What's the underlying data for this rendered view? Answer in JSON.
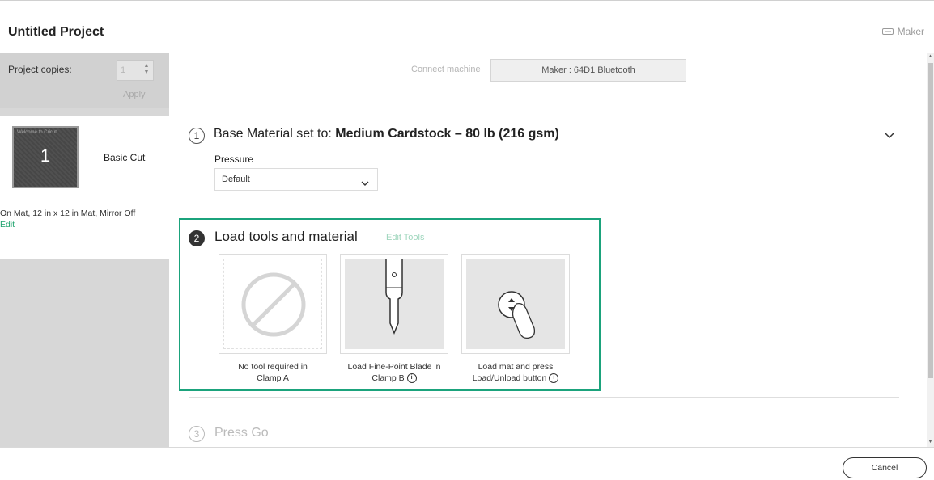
{
  "header": {
    "title": "Untitled Project",
    "machine_label": "Maker"
  },
  "sidebar": {
    "copies_label": "Project copies:",
    "copies_value": "1",
    "apply_label": "Apply",
    "mat": {
      "number": "1",
      "thumb_tag": "Welcome to Cricut",
      "label": "Basic Cut",
      "description": "On Mat, 12 in x 12 in Mat, Mirror Off",
      "edit_label": "Edit"
    }
  },
  "connect": {
    "label": "Connect machine",
    "selected": "Maker : 64D1 Bluetooth"
  },
  "step1": {
    "number": "1",
    "prefix": "Base Material set to:",
    "material": "Medium Cardstock – 80 lb (216 gsm)",
    "pressure_label": "Pressure",
    "pressure_value": "Default"
  },
  "step2": {
    "number": "2",
    "title": "Load tools and material",
    "edit_tools": "Edit Tools",
    "tools": [
      {
        "caption_line1": "No tool required in",
        "caption_line2": "Clamp A"
      },
      {
        "caption_line1": "Load Fine-Point Blade in",
        "caption_line2": "Clamp B"
      },
      {
        "caption_line1": "Load mat and press",
        "caption_line2": "Load/Unload button"
      }
    ]
  },
  "step3": {
    "number": "3",
    "title": "Press Go"
  },
  "footer": {
    "cancel_label": "Cancel"
  },
  "colors": {
    "accent": "#1ba37c",
    "edit_link": "#1ea36d"
  }
}
